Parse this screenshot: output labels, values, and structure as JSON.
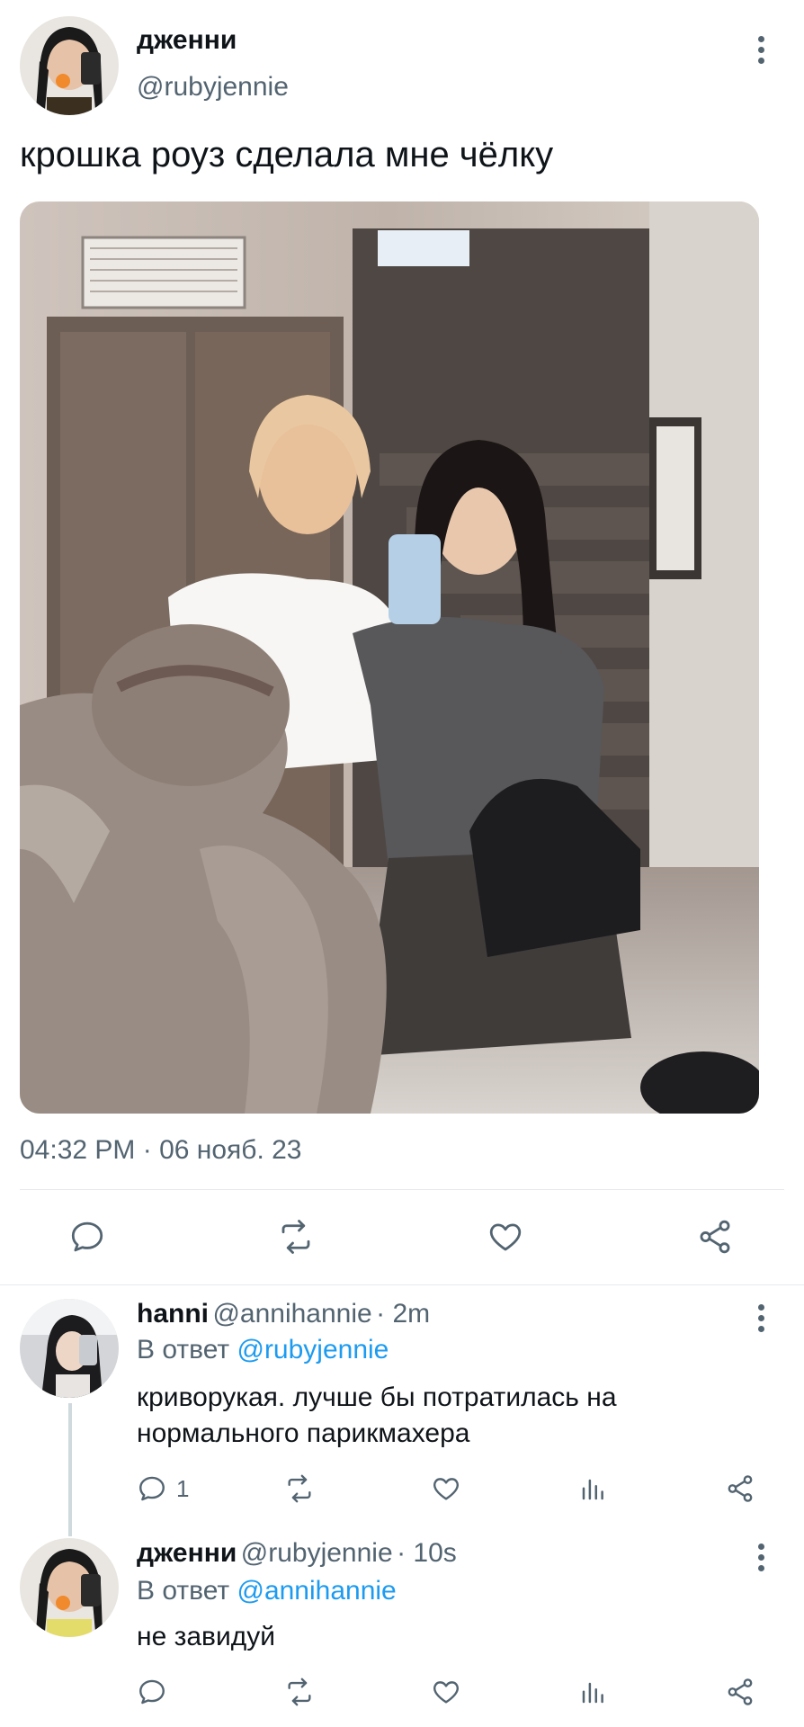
{
  "tweet": {
    "author_name": "дженни",
    "author_handle": "@rubyjennie",
    "text": "крошка роуз сделала мне чёлку",
    "timestamp": "04:32 PM · 06 нояб. 23"
  },
  "replies": [
    {
      "name": "hanni",
      "handle": "@annihannie",
      "time": "· 2m",
      "reply_prefix": "В ответ",
      "reply_to": "@rubyjennie",
      "text_line1": "криворукая. лучше бы потратилась на",
      "text_line2": "нормального парикмахера",
      "reply_count": "1"
    },
    {
      "name": "дженни",
      "handle": "@rubyjennie",
      "time": "· 10s",
      "reply_prefix": "В ответ",
      "reply_to": "@annihannie",
      "text_line1": "не завидуй"
    }
  ],
  "icons": {
    "reply": "speech-bubble-icon",
    "retweet": "retweet-icon",
    "like": "heart-icon",
    "share": "share-icon",
    "analytics": "bar-chart-icon",
    "more": "vertical-dots-icon"
  },
  "colors": {
    "link": "#1d9bf0",
    "secondary_text": "#536471",
    "primary_text": "#0f1419"
  }
}
